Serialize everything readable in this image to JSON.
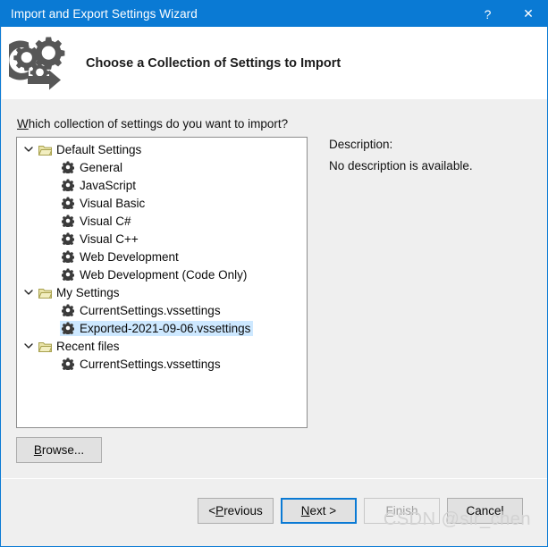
{
  "window": {
    "title": "Import and Export Settings Wizard",
    "help_button": "?",
    "close_button": "✕",
    "accent_color": "#0a7ad4",
    "titlebar_text_color": "#ffffff"
  },
  "header": {
    "icon": "gears-arrow-icon",
    "title": "Choose a Collection of Settings to Import"
  },
  "main": {
    "prompt_accel": "W",
    "prompt_rest": "hich collection of settings do you want to import?",
    "tree": {
      "expander_collapsed_glyph": "›",
      "expander_expanded_glyph": "⌄",
      "selection_color": "#cde8ff",
      "items": [
        {
          "label": "Default Settings",
          "level": 0,
          "icon": "folder-icon",
          "expanded": true,
          "selected": false
        },
        {
          "label": "General",
          "level": 1,
          "icon": "gear-icon",
          "expanded": false,
          "selected": false
        },
        {
          "label": "JavaScript",
          "level": 1,
          "icon": "gear-icon",
          "expanded": false,
          "selected": false
        },
        {
          "label": "Visual Basic",
          "level": 1,
          "icon": "gear-icon",
          "expanded": false,
          "selected": false
        },
        {
          "label": "Visual C#",
          "level": 1,
          "icon": "gear-icon",
          "expanded": false,
          "selected": false
        },
        {
          "label": "Visual C++",
          "level": 1,
          "icon": "gear-icon",
          "expanded": false,
          "selected": false
        },
        {
          "label": "Web Development",
          "level": 1,
          "icon": "gear-icon",
          "expanded": false,
          "selected": false
        },
        {
          "label": "Web Development (Code Only)",
          "level": 1,
          "icon": "gear-icon",
          "expanded": false,
          "selected": false
        },
        {
          "label": "My Settings",
          "level": 0,
          "icon": "folder-icon",
          "expanded": true,
          "selected": false
        },
        {
          "label": "CurrentSettings.vssettings",
          "level": 1,
          "icon": "gear-icon",
          "expanded": false,
          "selected": false
        },
        {
          "label": "Exported-2021-09-06.vssettings",
          "level": 1,
          "icon": "gear-icon",
          "expanded": false,
          "selected": true
        },
        {
          "label": "Recent files",
          "level": 0,
          "icon": "folder-icon",
          "expanded": true,
          "selected": false
        },
        {
          "label": "CurrentSettings.vssettings",
          "level": 1,
          "icon": "gear-icon",
          "expanded": false,
          "selected": false
        }
      ]
    },
    "description": {
      "heading": "Description:",
      "text": "No description is available."
    },
    "browse_accel": "B",
    "browse_rest": "rowse..."
  },
  "footer": {
    "buttons": [
      {
        "name": "previous",
        "prefix": "< ",
        "accel": "P",
        "rest": "revious",
        "state": "normal"
      },
      {
        "name": "next",
        "prefix": "",
        "accel": "N",
        "rest": "ext >",
        "state": "default"
      },
      {
        "name": "finish",
        "prefix": "",
        "accel": "F",
        "rest": "inish",
        "state": "disabled"
      },
      {
        "name": "cancel",
        "prefix": "",
        "accel": "",
        "rest": "Cancel",
        "state": "normal"
      }
    ]
  },
  "watermark": {
    "text": "CSDN @sir_chen"
  }
}
